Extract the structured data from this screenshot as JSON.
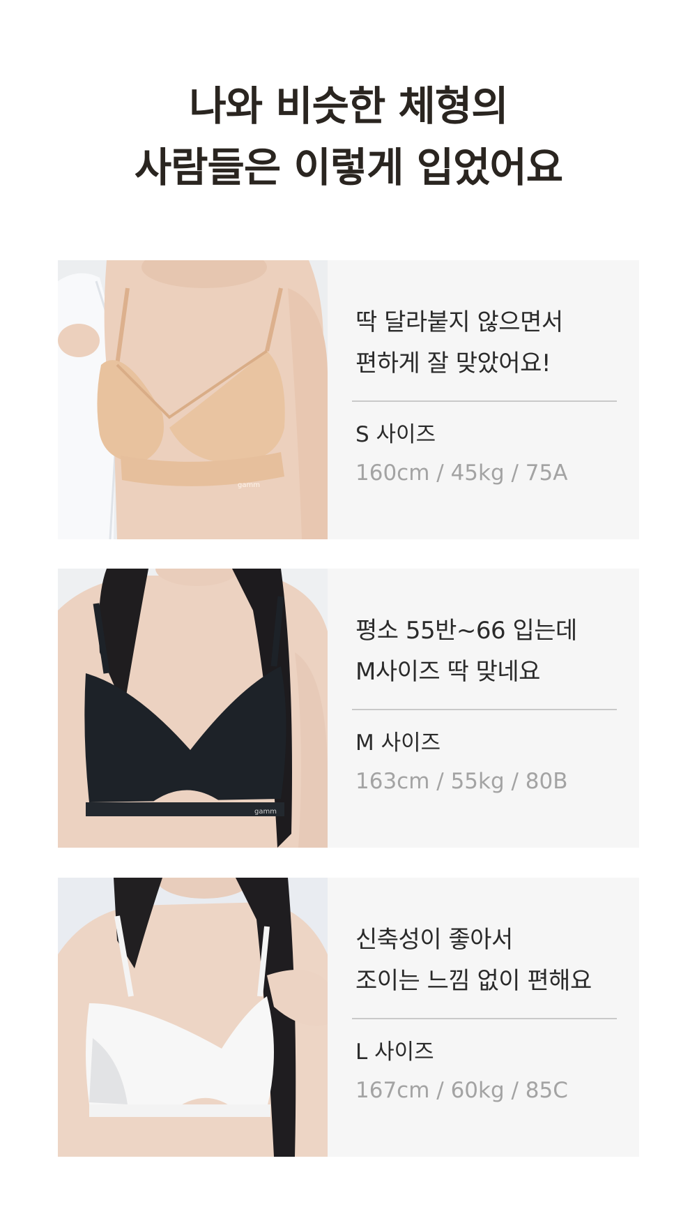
{
  "headline": {
    "line1": "나와 비슷한 체형의",
    "line2": "사람들은 이렇게 입었어요"
  },
  "colors": {
    "card_bg": "#f6f6f6",
    "title_text": "#2a2520",
    "spec_text": "#a3a3a3",
    "bra_beige": "#e7c3a0",
    "bra_black": "#1d2228",
    "bra_white": "#f7f7f7"
  },
  "reviews": [
    {
      "quote_line1": "딱 달라붙지 않으면서",
      "quote_line2": "편하게 잘 맞았어요!",
      "size_label": "S 사이즈",
      "spec": "160cm / 45kg / 75A",
      "image": "model-beige-bra-photo",
      "band_text": "gamm"
    },
    {
      "quote_line1": "평소 55반~66 입는데",
      "quote_line2": "M사이즈 딱 맞네요",
      "size_label": "M 사이즈",
      "spec": "163cm / 55kg / 80B",
      "image": "model-black-bra-photo",
      "band_text": "gamm"
    },
    {
      "quote_line1": "신축성이 좋아서",
      "quote_line2": "조이는 느낌 없이 편해요",
      "size_label": "L 사이즈",
      "spec": "167cm / 60kg / 85C",
      "image": "model-white-bra-photo",
      "band_text": ""
    }
  ]
}
